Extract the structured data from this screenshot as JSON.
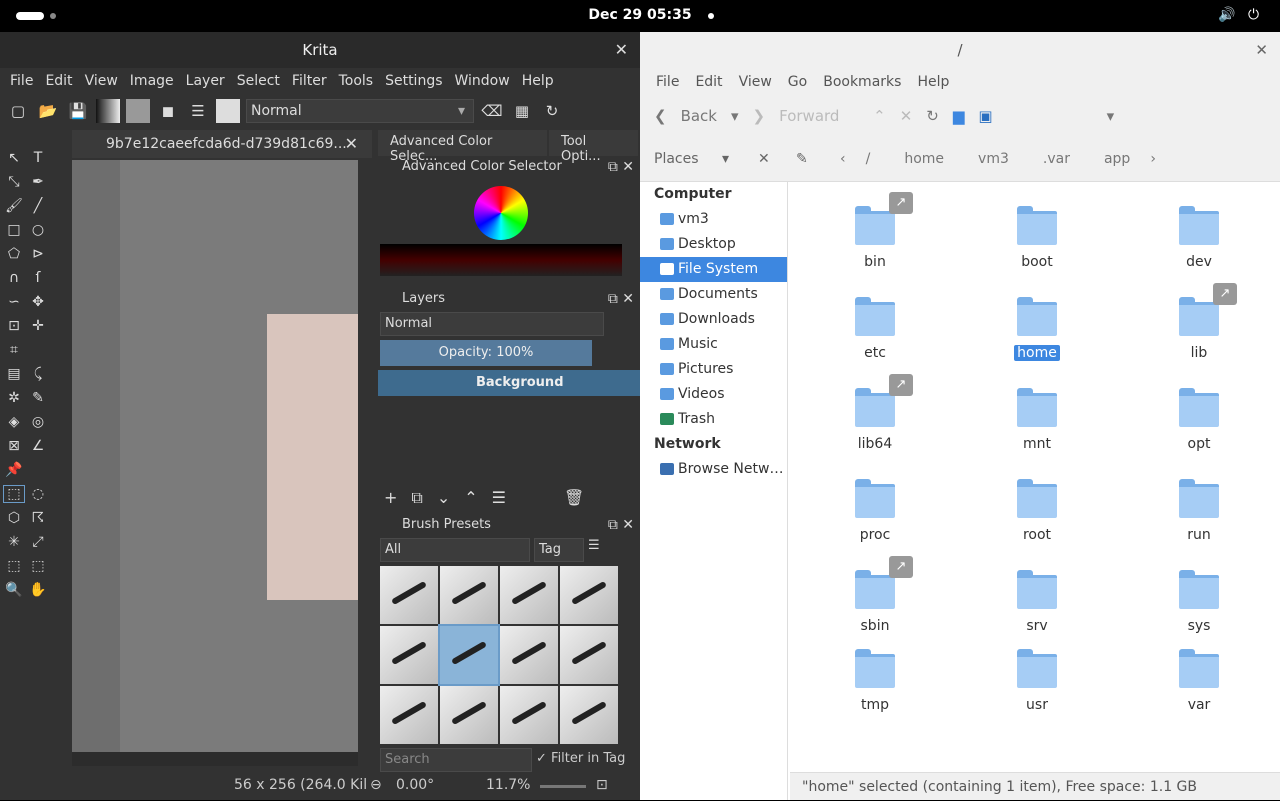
{
  "topbar": {
    "clock": "Dec 29  05:35"
  },
  "krita": {
    "title": "Krita",
    "menu": [
      "File",
      "Edit",
      "View",
      "Image",
      "Layer",
      "Select",
      "Filter",
      "Tools",
      "Settings",
      "Window",
      "Help"
    ],
    "blend_mode": "Normal",
    "doc_tab": "9b7e12caeefcda6d-d739d81c69...",
    "dock_tabs": [
      "Advanced Color Selec...",
      "Tool Opti..."
    ],
    "color_selector_title": "Advanced Color Selector",
    "layers_title": "Layers",
    "layers_blend": "Normal",
    "opacity": "Opacity:  100%",
    "layer_name": "Background",
    "brush_presets_title": "Brush Presets",
    "brush_filter": "All",
    "tag_label": "Tag",
    "search_placeholder": "Search",
    "filter_in_tag": "Filter in Tag",
    "status_size": "56 x 256 (264.0 Kil",
    "status_rotation": "0.00°",
    "status_zoom": "11.7%"
  },
  "files": {
    "title": "/",
    "menu": [
      "File",
      "Edit",
      "View",
      "Go",
      "Bookmarks",
      "Help"
    ],
    "back": "Back",
    "forward": "Forward",
    "places_label": "Places",
    "breadcrumb": [
      "/",
      "home",
      "vm3",
      ".var",
      "app"
    ],
    "computer_header": "Computer",
    "places": [
      "vm3",
      "Desktop",
      "File System",
      "Documents",
      "Downloads",
      "Music",
      "Pictures",
      "Videos",
      "Trash"
    ],
    "network_header": "Network",
    "network_items": [
      "Browse Netw…"
    ],
    "folders": [
      "bin",
      "boot",
      "dev",
      "etc",
      "home",
      "lib",
      "lib64",
      "mnt",
      "opt",
      "proc",
      "root",
      "run",
      "sbin",
      "srv",
      "sys",
      "tmp",
      "usr",
      "var"
    ],
    "status": "\"home\" selected (containing 1 item), Free space: 1.1 GB"
  }
}
